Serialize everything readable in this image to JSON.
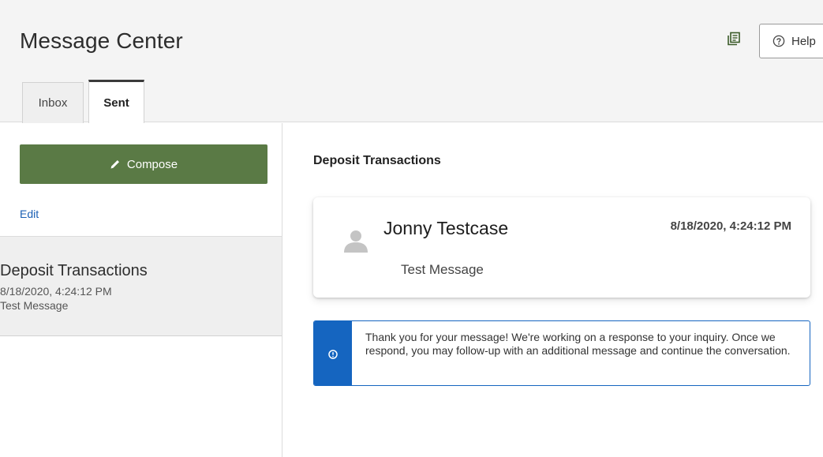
{
  "header": {
    "title": "Message Center",
    "help_label": "Help"
  },
  "icons": {
    "print": "print-icon",
    "help": "help-circle-icon",
    "compose": "pencil-icon",
    "avatar": "person-icon",
    "info": "info-icon"
  },
  "colors": {
    "compose_button": "#5a7a45",
    "info_accent": "#1565c0",
    "link": "#1a5fb4"
  },
  "tabs": [
    {
      "label": "Inbox",
      "active": false
    },
    {
      "label": "Sent",
      "active": true
    }
  ],
  "sidebar": {
    "compose_label": "Compose",
    "edit_label": "Edit",
    "messages": [
      {
        "subject": "Deposit Transactions",
        "date": "8/18/2020, 4:24:12 PM",
        "preview": "Test Message"
      }
    ]
  },
  "detail": {
    "subject": "Deposit Transactions",
    "message": {
      "sender": "Jonny Testcase",
      "timestamp": "8/18/2020, 4:24:12 PM",
      "body": "Test Message"
    },
    "notice": "Thank you for your message! We're working on a response to your inquiry. Once we respond, you may follow-up with an additional message and continue the conversation."
  }
}
